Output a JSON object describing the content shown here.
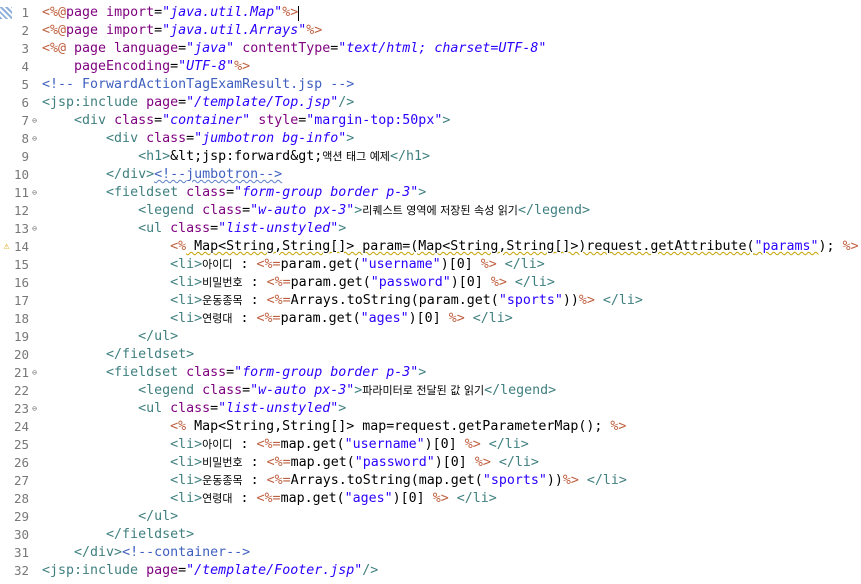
{
  "editor": {
    "file_comment": "ForwardActionTagExamResult.jsp",
    "colors": {
      "tag": "#3f7f7f",
      "attribute": "#7f007f",
      "string": "#2a00ff",
      "jsp_delimiter": "#bf5f3f",
      "comment": "#3f5fbf",
      "line_number": "#787878",
      "warning": "#d8a300"
    },
    "warning_line": 14,
    "icons": {
      "warning": "warning-icon",
      "fold": "fold-collapse-icon"
    },
    "lines": [
      {
        "n": "1",
        "fold": "",
        "tokens": [
          [
            "jsp",
            "<%@"
          ],
          [
            "attr",
            "page import"
          ],
          [
            "default",
            "="
          ],
          [
            "string",
            "\"java.util.Map\""
          ],
          [
            "jsp",
            "%>"
          ]
        ]
      },
      {
        "n": "2",
        "fold": "",
        "tokens": [
          [
            "jsp",
            "<%@"
          ],
          [
            "attr",
            "page import"
          ],
          [
            "default",
            "="
          ],
          [
            "string",
            "\"java.util.Arrays\""
          ],
          [
            "jsp",
            "%>"
          ]
        ]
      },
      {
        "n": "3",
        "fold": "",
        "tokens": [
          [
            "jsp",
            "<%@ "
          ],
          [
            "attr",
            "page language"
          ],
          [
            "default",
            "="
          ],
          [
            "string",
            "\"java\""
          ],
          [
            "default",
            " "
          ],
          [
            "attr",
            "contentType"
          ],
          [
            "default",
            "="
          ],
          [
            "string",
            "\"text/html; charset=UTF-8\""
          ]
        ]
      },
      {
        "n": "4",
        "fold": "",
        "tokens": [
          [
            "default",
            "    "
          ],
          [
            "attr",
            "pageEncoding"
          ],
          [
            "default",
            "="
          ],
          [
            "string",
            "\"UTF-8\""
          ],
          [
            "jsp",
            "%>"
          ]
        ]
      },
      {
        "n": "5",
        "fold": "",
        "tokens": [
          [
            "comment",
            "<!-- ForwardActionTagExamResult.jsp -->"
          ]
        ]
      },
      {
        "n": "6",
        "fold": "",
        "tokens": [
          [
            "tag",
            "<jsp:include "
          ],
          [
            "attr",
            "page"
          ],
          [
            "default",
            "="
          ],
          [
            "string",
            "\"/template/Top.jsp\""
          ],
          [
            "tag",
            "/>"
          ]
        ]
      },
      {
        "n": "7",
        "fold": "⊖",
        "tokens": [
          [
            "default",
            "    "
          ],
          [
            "tag",
            "<div "
          ],
          [
            "attr",
            "class"
          ],
          [
            "default",
            "="
          ],
          [
            "string",
            "\"container\""
          ],
          [
            "default",
            " "
          ],
          [
            "attr",
            "style"
          ],
          [
            "default",
            "="
          ],
          [
            "java-string",
            "\"margin-top:50px\""
          ],
          [
            "tag",
            ">"
          ]
        ]
      },
      {
        "n": "8",
        "fold": "⊖",
        "tokens": [
          [
            "default",
            "        "
          ],
          [
            "tag",
            "<div "
          ],
          [
            "attr",
            "class"
          ],
          [
            "default",
            "="
          ],
          [
            "string",
            "\"jumbotron bg-info\""
          ],
          [
            "tag",
            ">"
          ]
        ]
      },
      {
        "n": "9",
        "fold": "",
        "tokens": [
          [
            "default",
            "            "
          ],
          [
            "tag",
            "<h1>"
          ],
          [
            "default",
            "&lt;jsp:forward&gt;"
          ],
          [
            "kor",
            "액션 태그 예제"
          ],
          [
            "tag",
            "</h1>"
          ]
        ]
      },
      {
        "n": "10",
        "fold": "",
        "tokens": [
          [
            "default",
            "        "
          ],
          [
            "tag",
            "</div>"
          ],
          [
            "comment",
            "<!--jumbotron-->"
          ]
        ]
      },
      {
        "n": "11",
        "fold": "⊖",
        "tokens": [
          [
            "default",
            "        "
          ],
          [
            "tag",
            "<fieldset "
          ],
          [
            "attr",
            "class"
          ],
          [
            "default",
            "="
          ],
          [
            "string",
            "\"form-group border p-3\""
          ],
          [
            "tag",
            ">"
          ]
        ]
      },
      {
        "n": "12",
        "fold": "",
        "tokens": [
          [
            "default",
            "            "
          ],
          [
            "tag",
            "<legend "
          ],
          [
            "attr",
            "class"
          ],
          [
            "default",
            "="
          ],
          [
            "string",
            "\"w-auto px-3\""
          ],
          [
            "tag",
            ">"
          ],
          [
            "kor",
            "리퀘스트 영역에 저장된 속성 읽기"
          ],
          [
            "tag",
            "</legend>"
          ]
        ]
      },
      {
        "n": "13",
        "fold": "⊖",
        "tokens": [
          [
            "default",
            "            "
          ],
          [
            "tag",
            "<ul "
          ],
          [
            "attr",
            "class"
          ],
          [
            "default",
            "="
          ],
          [
            "string",
            "\"list-unstyled\""
          ],
          [
            "tag",
            ">"
          ]
        ]
      },
      {
        "n": "14",
        "fold": "",
        "tokens": [
          [
            "default",
            "                "
          ],
          [
            "jsp",
            "<%"
          ],
          [
            "default",
            " Map<String,String[]> param=(Map<String,String[]>)request.getAttribute("
          ],
          [
            "java-string",
            "\"params\""
          ],
          [
            "default",
            "); "
          ],
          [
            "jsp",
            "%>"
          ]
        ]
      },
      {
        "n": "15",
        "fold": "",
        "tokens": [
          [
            "default",
            "                "
          ],
          [
            "tag",
            "<li>"
          ],
          [
            "kor",
            "아이디"
          ],
          [
            "default",
            " : "
          ],
          [
            "jsp",
            "<%="
          ],
          [
            "default",
            "param.get("
          ],
          [
            "java-string",
            "\"username\""
          ],
          [
            "default",
            ")[0] "
          ],
          [
            "jsp",
            "%>"
          ],
          [
            "default",
            " "
          ],
          [
            "tag",
            "</li>"
          ]
        ]
      },
      {
        "n": "16",
        "fold": "",
        "tokens": [
          [
            "default",
            "                "
          ],
          [
            "tag",
            "<li>"
          ],
          [
            "kor",
            "비밀번호"
          ],
          [
            "default",
            " : "
          ],
          [
            "jsp",
            "<%="
          ],
          [
            "default",
            "param.get("
          ],
          [
            "java-string",
            "\"password\""
          ],
          [
            "default",
            ")[0] "
          ],
          [
            "jsp",
            "%>"
          ],
          [
            "default",
            " "
          ],
          [
            "tag",
            "</li>"
          ]
        ]
      },
      {
        "n": "17",
        "fold": "",
        "tokens": [
          [
            "default",
            "                "
          ],
          [
            "tag",
            "<li>"
          ],
          [
            "kor",
            "운동종목"
          ],
          [
            "default",
            " : "
          ],
          [
            "jsp",
            "<%="
          ],
          [
            "default",
            "Arrays.toString(param.get("
          ],
          [
            "java-string",
            "\"sports\""
          ],
          [
            "default",
            "))"
          ],
          [
            "jsp",
            "%>"
          ],
          [
            "default",
            " "
          ],
          [
            "tag",
            "</li>"
          ]
        ]
      },
      {
        "n": "18",
        "fold": "",
        "tokens": [
          [
            "default",
            "                "
          ],
          [
            "tag",
            "<li>"
          ],
          [
            "kor",
            "연령대"
          ],
          [
            "default",
            " : "
          ],
          [
            "jsp",
            "<%="
          ],
          [
            "default",
            "param.get("
          ],
          [
            "java-string",
            "\"ages\""
          ],
          [
            "default",
            ")[0] "
          ],
          [
            "jsp",
            "%>"
          ],
          [
            "default",
            " "
          ],
          [
            "tag",
            "</li>"
          ]
        ]
      },
      {
        "n": "19",
        "fold": "",
        "tokens": [
          [
            "default",
            "            "
          ],
          [
            "tag",
            "</ul>"
          ]
        ]
      },
      {
        "n": "20",
        "fold": "",
        "tokens": [
          [
            "default",
            "        "
          ],
          [
            "tag",
            "</fieldset>"
          ]
        ]
      },
      {
        "n": "21",
        "fold": "⊖",
        "tokens": [
          [
            "default",
            "        "
          ],
          [
            "tag",
            "<fieldset "
          ],
          [
            "attr",
            "class"
          ],
          [
            "default",
            "="
          ],
          [
            "string",
            "\"form-group border p-3\""
          ],
          [
            "tag",
            ">"
          ]
        ]
      },
      {
        "n": "22",
        "fold": "",
        "tokens": [
          [
            "default",
            "            "
          ],
          [
            "tag",
            "<legend "
          ],
          [
            "attr",
            "class"
          ],
          [
            "default",
            "="
          ],
          [
            "string",
            "\"w-auto px-3\""
          ],
          [
            "tag",
            ">"
          ],
          [
            "kor",
            "파라미터로 전달된 값 읽기"
          ],
          [
            "tag",
            "</legend>"
          ]
        ]
      },
      {
        "n": "23",
        "fold": "⊖",
        "tokens": [
          [
            "default",
            "            "
          ],
          [
            "tag",
            "<ul "
          ],
          [
            "attr",
            "class"
          ],
          [
            "default",
            "="
          ],
          [
            "string",
            "\"list-unstyled\""
          ],
          [
            "tag",
            ">"
          ]
        ]
      },
      {
        "n": "24",
        "fold": "",
        "tokens": [
          [
            "default",
            "                "
          ],
          [
            "jsp",
            "<%"
          ],
          [
            "default",
            " Map<String,String[]> map=request.getParameterMap(); "
          ],
          [
            "jsp",
            "%>"
          ]
        ]
      },
      {
        "n": "25",
        "fold": "",
        "tokens": [
          [
            "default",
            "                "
          ],
          [
            "tag",
            "<li>"
          ],
          [
            "kor",
            "아이디"
          ],
          [
            "default",
            " : "
          ],
          [
            "jsp",
            "<%="
          ],
          [
            "default",
            "map.get("
          ],
          [
            "java-string",
            "\"username\""
          ],
          [
            "default",
            ")[0] "
          ],
          [
            "jsp",
            "%>"
          ],
          [
            "default",
            " "
          ],
          [
            "tag",
            "</li>"
          ]
        ]
      },
      {
        "n": "26",
        "fold": "",
        "tokens": [
          [
            "default",
            "                "
          ],
          [
            "tag",
            "<li>"
          ],
          [
            "kor",
            "비밀번호"
          ],
          [
            "default",
            " : "
          ],
          [
            "jsp",
            "<%="
          ],
          [
            "default",
            "map.get("
          ],
          [
            "java-string",
            "\"password\""
          ],
          [
            "default",
            ")[0] "
          ],
          [
            "jsp",
            "%>"
          ],
          [
            "default",
            " "
          ],
          [
            "tag",
            "</li>"
          ]
        ]
      },
      {
        "n": "27",
        "fold": "",
        "tokens": [
          [
            "default",
            "                "
          ],
          [
            "tag",
            "<li>"
          ],
          [
            "kor",
            "운동종목"
          ],
          [
            "default",
            " : "
          ],
          [
            "jsp",
            "<%="
          ],
          [
            "default",
            "Arrays.toString(map.get("
          ],
          [
            "java-string",
            "\"sports\""
          ],
          [
            "default",
            "))"
          ],
          [
            "jsp",
            "%>"
          ],
          [
            "default",
            " "
          ],
          [
            "tag",
            "</li>"
          ]
        ]
      },
      {
        "n": "28",
        "fold": "",
        "tokens": [
          [
            "default",
            "                "
          ],
          [
            "tag",
            "<li>"
          ],
          [
            "kor",
            "연령대"
          ],
          [
            "default",
            " : "
          ],
          [
            "jsp",
            "<%="
          ],
          [
            "default",
            "map.get("
          ],
          [
            "java-string",
            "\"ages\""
          ],
          [
            "default",
            ")[0] "
          ],
          [
            "jsp",
            "%>"
          ],
          [
            "default",
            " "
          ],
          [
            "tag",
            "</li>"
          ]
        ]
      },
      {
        "n": "29",
        "fold": "",
        "tokens": [
          [
            "default",
            "            "
          ],
          [
            "tag",
            "</ul>"
          ]
        ]
      },
      {
        "n": "30",
        "fold": "",
        "tokens": [
          [
            "default",
            "        "
          ],
          [
            "tag",
            "</fieldset>"
          ]
        ]
      },
      {
        "n": "31",
        "fold": "",
        "tokens": [
          [
            "default",
            "    "
          ],
          [
            "tag",
            "</div>"
          ],
          [
            "comment",
            "<!--container-->"
          ]
        ]
      },
      {
        "n": "32",
        "fold": "",
        "tokens": [
          [
            "tag",
            "<jsp:include "
          ],
          [
            "attr",
            "page"
          ],
          [
            "default",
            "="
          ],
          [
            "string",
            "\"/template/Footer.jsp\""
          ],
          [
            "tag",
            "/>"
          ]
        ]
      }
    ]
  }
}
